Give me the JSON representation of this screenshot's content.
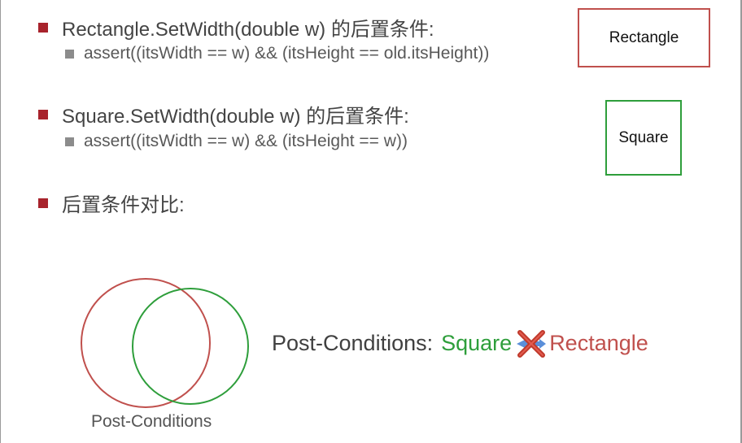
{
  "bullets": {
    "rect_post": "Rectangle.SetWidth(double w) 的后置条件:",
    "rect_assert": "assert((itsWidth == w) && (itsHeight == old.itsHeight))",
    "square_post": "Square.SetWidth(double w) 的后置条件:",
    "square_assert": "assert((itsWidth == w) && (itsHeight == w))",
    "compare": "后置条件对比:"
  },
  "boxes": {
    "rectangle": "Rectangle",
    "square": "Square"
  },
  "venn": {
    "label": "Post-Conditions"
  },
  "relation": {
    "prefix": "Post-Conditions:",
    "left": "Square",
    "symbol": "cross-out-arrow-icon",
    "right": "Rectangle"
  },
  "colors": {
    "bullet_red": "#a8232c",
    "rectangle": "#c0504d",
    "square": "#2e9e3b",
    "sub_bullet": "#8c8c8c"
  }
}
